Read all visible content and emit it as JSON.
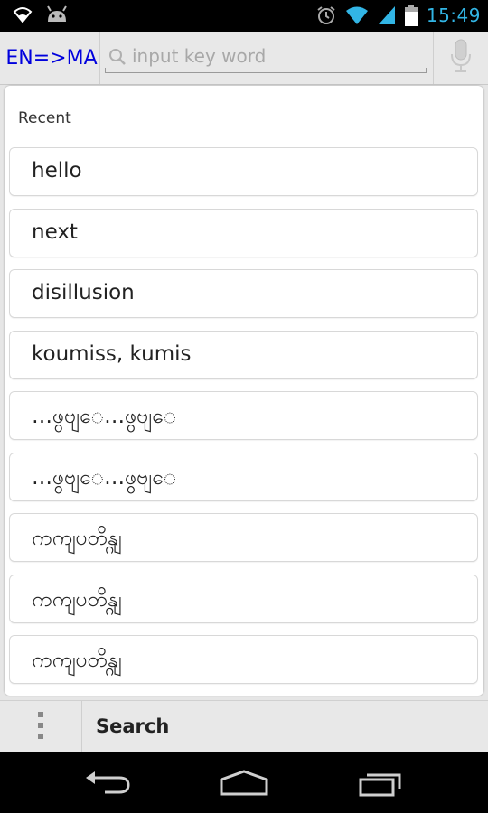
{
  "status_bar": {
    "time": "15:49",
    "icons": [
      "wifi-icon",
      "android-icon",
      "alarm-icon",
      "wifi-signal-icon",
      "cell-signal-icon",
      "battery-icon"
    ]
  },
  "toolbar": {
    "lang_label": "EN=>MA",
    "search_placeholder": "input key word",
    "search_value": ""
  },
  "recent": {
    "label": "Recent",
    "items": [
      "hello",
      "next",
      "disillusion",
      "koumiss, kumis",
      "…ဖွ​ဗျ​ေ…ဖွ​ဗျ​ေ",
      "…ဖွ​ဗျ​ေ…ဖွ​ဗျ​ေ",
      "ကကျ​ပတိန္ဂျ",
      "ကကျ​ပတိန္ဂျ",
      "ကကျ​ပတိန္ဂျ",
      ""
    ]
  },
  "bottom_bar": {
    "search_label": "Search"
  },
  "colors": {
    "accent_blue": "#0000dd",
    "time_blue": "#32b5e5"
  }
}
